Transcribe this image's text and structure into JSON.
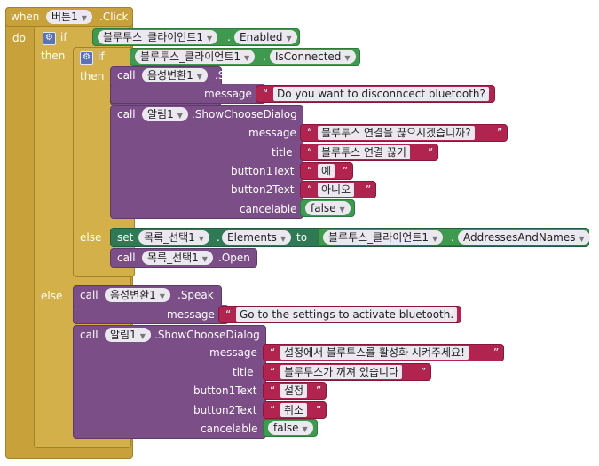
{
  "event": {
    "when": "when",
    "component": "버튼1",
    "event_name": ".Click",
    "do": "do"
  },
  "if1": {
    "if": "if",
    "then": "then",
    "else": "else",
    "cond_component": "블루투스_클라이언트1",
    "cond_property": "Enabled"
  },
  "if2": {
    "if": "if",
    "then": "then",
    "else": "else",
    "cond_component": "블루투스_클라이언트1",
    "cond_property": "IsConnected"
  },
  "then_speak": {
    "call": "call",
    "component": "음성변환1",
    "method": ".Speak",
    "param_label": "message",
    "text": "Do you want to disconncect bluetooth?"
  },
  "then_dialog": {
    "call": "call",
    "component": "알림1",
    "method": ".ShowChooseDialog",
    "params": [
      {
        "label": "message",
        "text": "블루투스 연결을 끊으시겠습니까?"
      },
      {
        "label": "title",
        "text": "블루투스 연결 끊기"
      },
      {
        "label": "button1Text",
        "text": "예"
      },
      {
        "label": "button2Text",
        "text": "아니오"
      }
    ],
    "cancelable_label": "cancelable",
    "cancelable_value": "false"
  },
  "else2_set": {
    "set": "set",
    "component": "목록_선택1",
    "property": "Elements",
    "to": "to",
    "src_component": "블루투스_클라이언트1",
    "src_property": "AddressesAndNames"
  },
  "else2_open": {
    "call": "call",
    "component": "목록_선택1",
    "method": ".Open"
  },
  "else_speak": {
    "call": "call",
    "component": "음성변환1",
    "method": ".Speak",
    "param_label": "message",
    "text": "Go to the settings to activate bluetooth."
  },
  "else_dialog": {
    "call": "call",
    "component": "알림1",
    "method": ".ShowChooseDialog",
    "params": [
      {
        "label": "message",
        "text": "설정에서 블루투스를 활성화 시켜주세요!"
      },
      {
        "label": "title",
        "text": "블루투스가 꺼져 있습니다"
      },
      {
        "label": "button1Text",
        "text": "설정"
      },
      {
        "label": "button2Text",
        "text": "취소"
      }
    ],
    "cancelable_label": "cancelable",
    "cancelable_value": "false"
  },
  "icons": {
    "gear": "gear-icon",
    "dropdown": "dropdown-arrow-icon"
  },
  "colors": {
    "event": "#c8a13a",
    "procedure": "#7b4e88",
    "setter": "#2f7a55",
    "getter": "#3e9a4f",
    "text": "#b0244f",
    "logic": "#3e9a4f"
  }
}
